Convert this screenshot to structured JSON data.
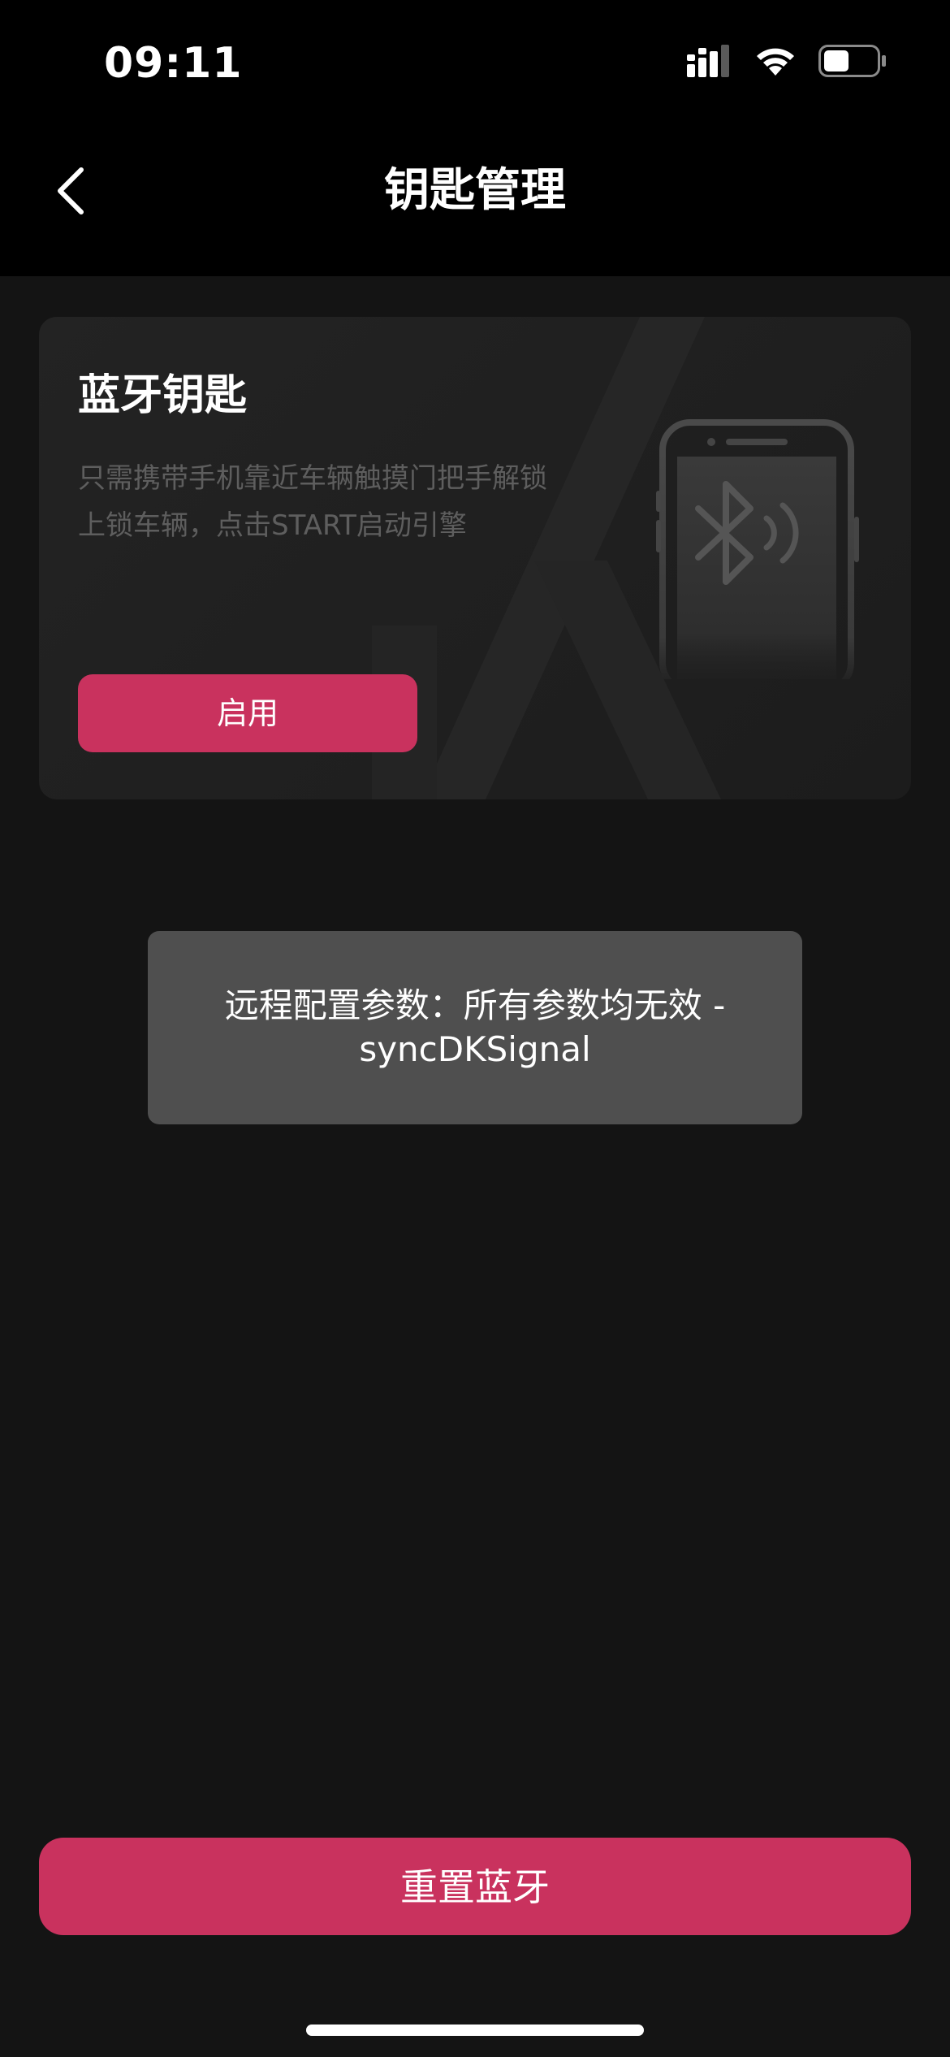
{
  "status_bar": {
    "time": "09:11",
    "icons": [
      "signal-icon",
      "wifi-icon",
      "battery-icon"
    ]
  },
  "nav": {
    "back_icon": "chevron-left-icon",
    "title": "钥匙管理"
  },
  "card": {
    "title": "蓝牙钥匙",
    "description_line1": "只需携带手机靠近车辆触摸门把手解锁",
    "description_line2": "上锁车辆，点击START启动引擎",
    "enable_label": "启用",
    "illustration_icon": "phone-bluetooth-icon"
  },
  "toast": {
    "line1": "远程配置参数：所有参数均无效 -",
    "line2": "syncDKSignal"
  },
  "bottom": {
    "reset_label": "重置蓝牙"
  },
  "colors": {
    "accent": "#c9325e",
    "background": "#141414",
    "header": "#000000",
    "card": "#222222",
    "toast": "#4f4f4f",
    "muted_text": "#5e5e5e"
  }
}
